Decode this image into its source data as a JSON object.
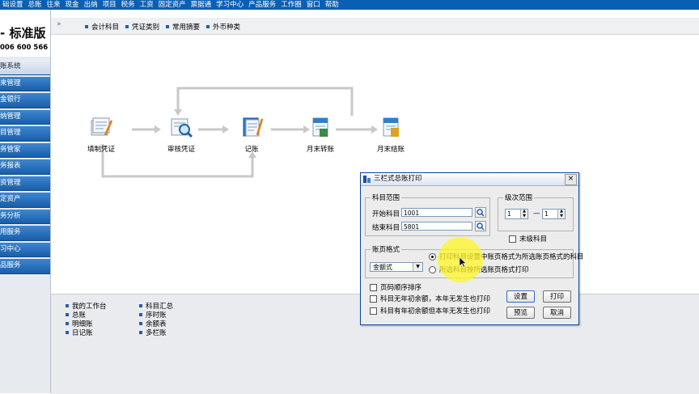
{
  "menubar": {
    "items": [
      "础设置",
      "总账",
      "往来",
      "现金",
      "出纳",
      "项目",
      "税务",
      "工资",
      "固定资产",
      "票据通",
      "学习中心",
      "产品服务",
      "工作圈",
      "窗口",
      "帮助"
    ]
  },
  "brand": {
    "title": "- 标准版",
    "phone": "006 600 566"
  },
  "sidebar": {
    "items": [
      "账系统",
      "来管理",
      "金银行",
      "纳管理",
      "目管理",
      "务管家",
      "务报表",
      "资管理",
      "定资产",
      "务分析",
      "用服务",
      "习中心",
      "品服务"
    ]
  },
  "toolbar": {
    "arrows": "»",
    "items": [
      "会计科目",
      "凭证类别",
      "常用摘要",
      "外币种类"
    ]
  },
  "flow": {
    "nodes": [
      "填制凭证",
      "审核凭证",
      "记账",
      "月末转账",
      "月末结账"
    ]
  },
  "bottom_links": {
    "col1": [
      "我的工作台",
      "总账",
      "明细账",
      "日记账"
    ],
    "col2": [
      "科目汇总",
      "序时账",
      "余额表",
      "多栏账"
    ]
  },
  "dialog": {
    "title": "三栏式总账打印",
    "close_label": "×",
    "subject_range_legend": "科目范围",
    "start_label": "开始科目",
    "start_value": "1001",
    "end_label": "结束科目",
    "end_value": "5801",
    "level_legend": "级次范围",
    "level_from": "1",
    "level_to": "1",
    "level_dash": "—",
    "leaf_only_label": "末级科目",
    "format_legend": "账页格式",
    "format_select": "金额式",
    "radio1_label": "打印科目设置中账页格式为所选账页格式的科目",
    "radio2_label": "所选科目按所选账页格式打印",
    "check_page_order": "页码顺序排序",
    "check_no_opening": "科目无年初余额，本年无发生也打印",
    "check_has_opening": "科目有年初余额但本年无发生也打印",
    "btn_setup": "设置",
    "btn_print": "打印",
    "btn_preview": "预览",
    "btn_cancel": "取消"
  },
  "colors": {
    "menubar": "#0b5fb3",
    "sidebar_item": "#1a5ea9",
    "highlight": "#fff728"
  }
}
